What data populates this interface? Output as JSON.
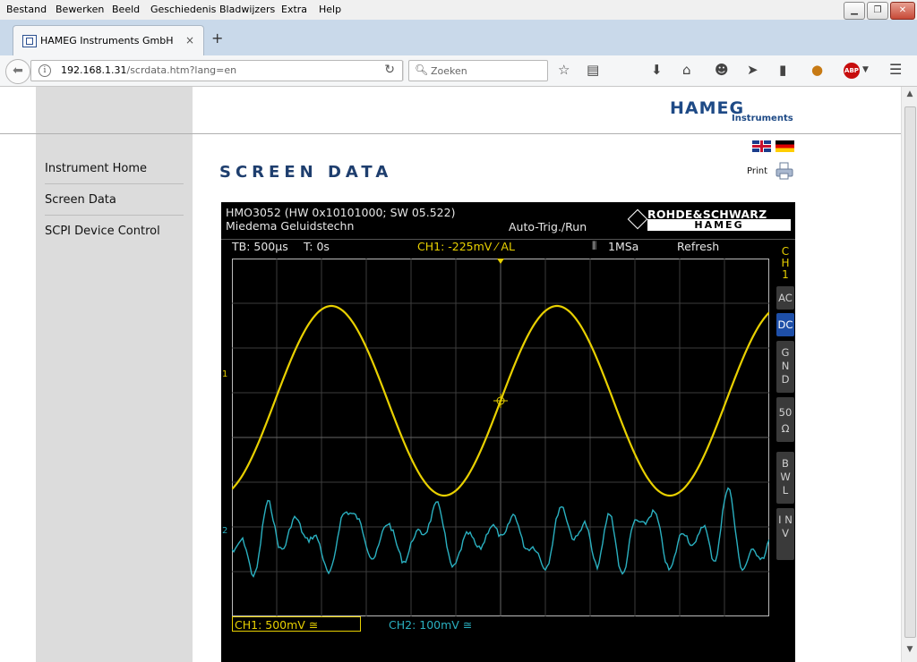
{
  "menubar": {
    "items": [
      "Bestand",
      "Bewerken",
      "Beeld",
      "Geschiedenis",
      "Bladwijzers",
      "Extra",
      "Help"
    ]
  },
  "tab": {
    "title": "HAMEG Instruments GmbH",
    "close": "×"
  },
  "new_tab": "+",
  "urlbar": {
    "host": "192.168.1.31",
    "path": "/scrdata.htm?lang=en"
  },
  "search": {
    "placeholder": "Zoeken"
  },
  "logo": {
    "main": "HAMEG",
    "sub": "Instruments"
  },
  "nav": {
    "items": [
      "Instrument Home",
      "Screen Data",
      "SCPI Device Control"
    ]
  },
  "page_title": "SCREEN DATA",
  "print_label": "Print",
  "scope": {
    "device": "HMO3052 (HW 0x10101000; SW 05.522)",
    "owner": "Miedema Geluidstechn",
    "trigger_mode": "Auto-Trig./Run",
    "brand_top": "ROHDE&SCHWARZ",
    "brand_bottom": "HAMEG",
    "timebase": "TB: 500µs",
    "trig_time": "T: 0s",
    "ch1_trigger": "CH1: -225mV ⁄ AL",
    "sample_rate": "1MSa",
    "refresh": "Refresh",
    "side_channel": "C H 1",
    "side_buttons": [
      "AC",
      "DC",
      "G N D",
      "50 Ω",
      "B W L",
      "I N V"
    ],
    "marker_ch1": "1",
    "marker_ch2": "2",
    "trig_marker": "◂T",
    "ch1_scale": "CH1: 500mV ≅",
    "ch2_scale": "CH2: 100mV ≅",
    "colors": {
      "ch1": "#e8d000",
      "ch2": "#2ab0c0",
      "active_button": "#1e4fa8"
    }
  }
}
